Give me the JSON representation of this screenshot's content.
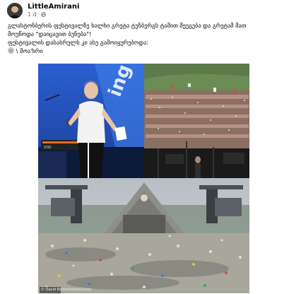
{
  "post": {
    "author": "LittleAmirani",
    "time": "1 d",
    "privacy_icon": "globe-icon",
    "caption_lines": [
      "გლასტონბერის ფესტივალზე ხალხი გრეტა ტუნბერგს ტაშით შეეგება და გრეტამ მათ",
      "მოუწოდა \"დაიცავით ბუნება\"!",
      "ფესტივალის დასასრულს კი ასე გამოიყურებოდა:",
      "\\ მოა'ხრი"
    ],
    "caption_emoji_icon": "neutral-face-emoji-icon"
  },
  "photos": {
    "credit": "© David Bartholomew/Getty"
  },
  "colors": {
    "author_text": "#050505",
    "meta_text": "#65676b",
    "background": "#ffffff"
  }
}
